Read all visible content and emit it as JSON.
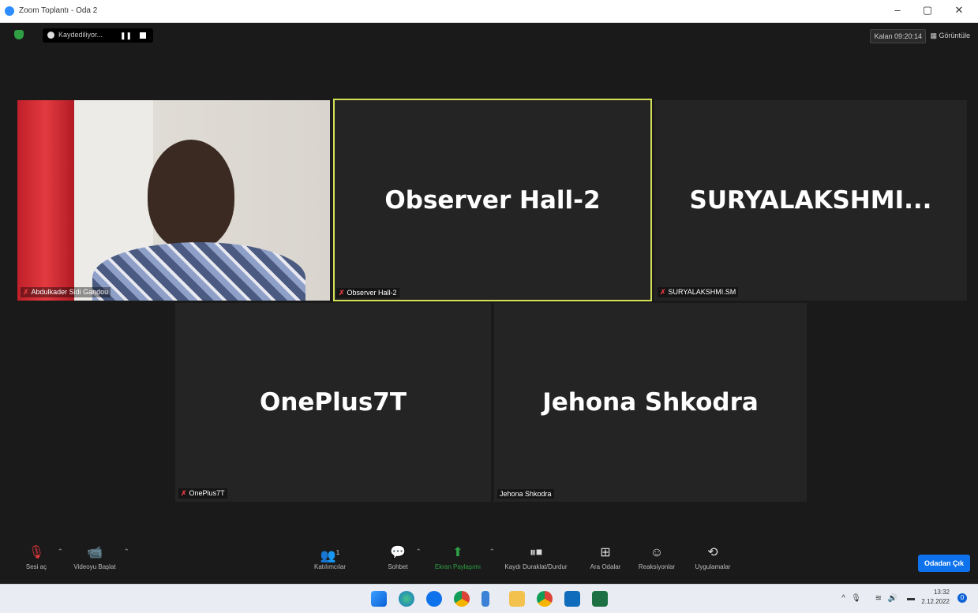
{
  "window": {
    "title": "Zoom Toplantı - Oda 2",
    "minimize": "–",
    "restore": "▢",
    "close": "✕"
  },
  "meeting_bar": {
    "recording_label": "Kaydediliyor...",
    "pause_glyph": "❚❚",
    "remaining_label": "Kalan 09:20:14",
    "view_label": "Görüntüle",
    "view_glyph": "▦"
  },
  "participants": [
    {
      "name_tag": "Abdulkader Sidi Gandou",
      "muted_glyph": "✗",
      "video_on": true
    },
    {
      "display_name": "Observer Hall-2",
      "name_tag": "Observer Hall-2",
      "muted_glyph": "✗",
      "active_speaker": true
    },
    {
      "display_name": "SURYALAKSHMI...",
      "name_tag": "SURYALAKSHMI.SM",
      "muted_glyph": "✗"
    },
    {
      "display_name": "OnePlus7T",
      "name_tag": "OnePlus7T",
      "muted_glyph": "✗"
    },
    {
      "display_name": "Jehona Shkodra",
      "name_tag": "Jehona Shkodra"
    }
  ],
  "toolbar": {
    "unmute": {
      "label": "Sesi aç",
      "icon": "microphone-muted-icon",
      "glyph": "🎙"
    },
    "start_video": {
      "label": "Videoyu Başlat",
      "icon": "camera-off-icon",
      "glyph": "📹"
    },
    "participants": {
      "label": "Katılımcılar",
      "icon": "participants-icon",
      "glyph": "👥",
      "count": "1"
    },
    "chat": {
      "label": "Sohbet",
      "icon": "chat-icon",
      "glyph": "💬"
    },
    "share": {
      "label": "Ekran Paylaşımı",
      "icon": "share-screen-icon",
      "glyph": "⬆"
    },
    "record": {
      "label": "Kaydı Duraklat/Durdur",
      "icon": "record-icon",
      "glyph": "⏸⏹"
    },
    "breakout": {
      "label": "Ara Odalar",
      "icon": "breakout-rooms-icon",
      "glyph": "⊞"
    },
    "reactions": {
      "label": "Reaksiyonlar",
      "icon": "reactions-icon",
      "glyph": "☺"
    },
    "apps": {
      "label": "Uygulamalar",
      "icon": "apps-icon",
      "glyph": "⟲"
    },
    "leave": {
      "label": "Odadan Çık"
    },
    "caret": "⌃"
  },
  "taskbar": {
    "apps": [
      "windows-start-icon",
      "edge-icon",
      "chrome-icon",
      "file-explorer-icon",
      "folder-icon",
      "chrome-2-icon",
      "outlook-icon",
      "excel-icon"
    ],
    "tray_glyphs": {
      "chevron": "^",
      "mic": "🎙",
      "wifi": "≋",
      "volume": "🔊",
      "battery": "▬"
    },
    "time": "13:32",
    "date": "2.12.2022",
    "notification_count": "0"
  },
  "colors": {
    "active_speaker_border": "#d4e157",
    "leave_button": "#0e72ed",
    "share_green": "#2ea043",
    "muted_red": "#e0393e"
  }
}
